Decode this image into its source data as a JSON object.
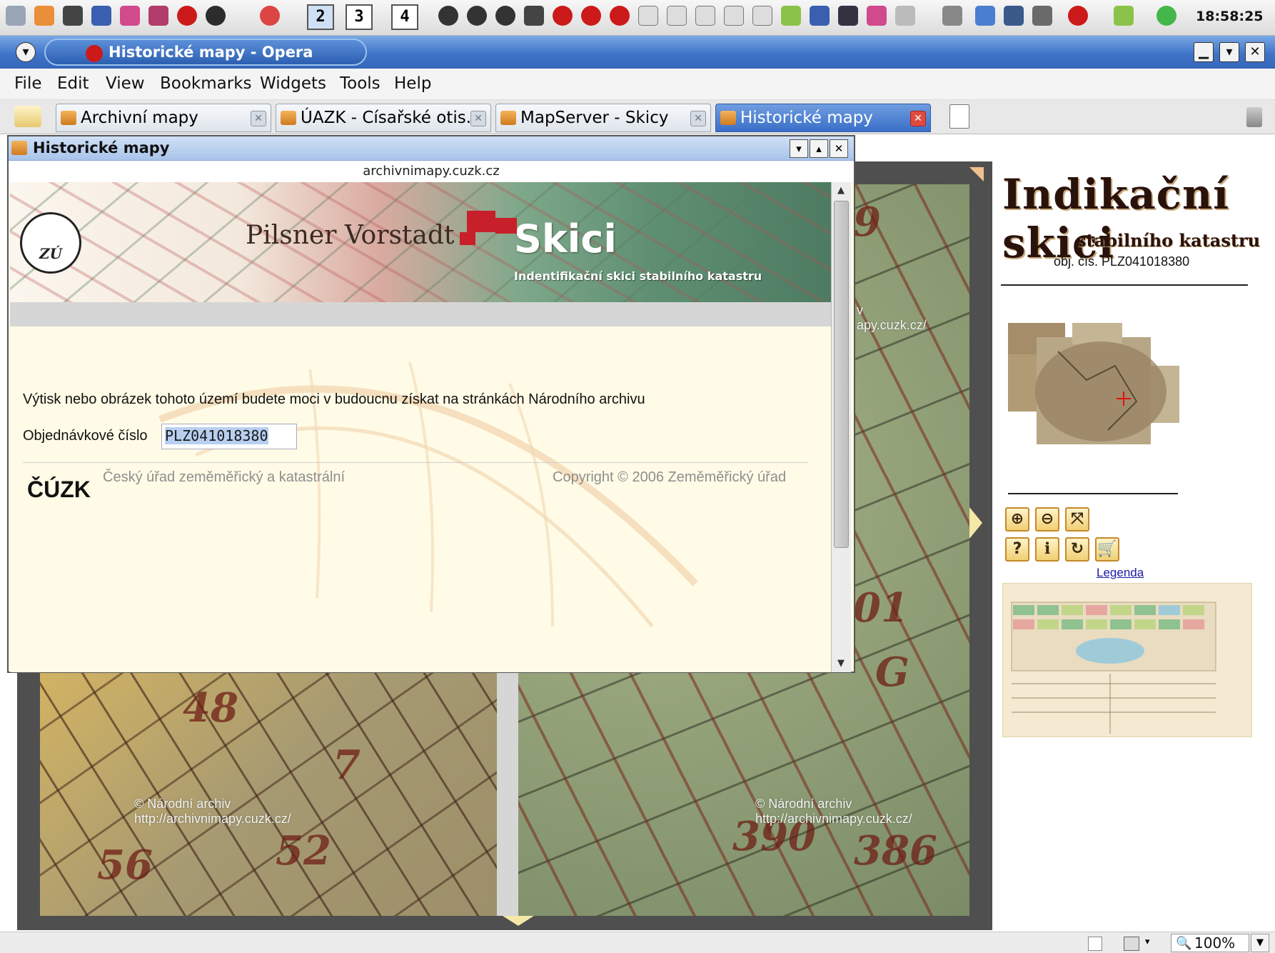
{
  "system_panel": {
    "desktops": [
      "2",
      "3",
      "4"
    ],
    "clock": "18:58:25"
  },
  "window": {
    "title": "Historické mapy - Opera"
  },
  "menu": {
    "items": [
      "File",
      "Edit",
      "View",
      "Bookmarks",
      "Widgets",
      "Tools",
      "Help"
    ]
  },
  "tabs": [
    {
      "label": "Archivní mapy",
      "active": false
    },
    {
      "label": "ÚAZK - Císařské otis...",
      "active": false
    },
    {
      "label": "MapServer - Skicy",
      "active": false
    },
    {
      "label": "Historické mapy",
      "active": true
    }
  ],
  "popup": {
    "title": "Historické mapy",
    "url": "archivnimapy.cuzk.cz",
    "banner": {
      "logo_text": "ZÚ",
      "script_text": "Pilsner Vorstadt",
      "title": "Skici",
      "subtitle": "Indentifikační skici stabilního katastru"
    },
    "notice": "Výtisk nebo obrázek tohoto území budete moci v budoucnu získat na stránkách Národního archivu",
    "order_label": "Objednávkové číslo",
    "order_value": "PLZ041018380",
    "footer": {
      "logo": "ČÚZK",
      "agency": "Český úřad zeměměřický a katastrální",
      "copyright": "Copyright © 2006 Zeměměřický úřad"
    }
  },
  "map": {
    "watermark_line1": "© Národní archiv",
    "watermark_line2": "http://archivnimapy.cuzk.cz/",
    "watermark_partial_line1": "v",
    "watermark_partial_line2": "apy.cuzk.cz/"
  },
  "right_panel": {
    "title": "Indikační skici",
    "subtitle": "stabilního katastru",
    "obj_number": "obj. čís. PLZ041018380",
    "tools_row1": [
      "zoom-in-icon",
      "zoom-out-icon",
      "fit-extent-icon"
    ],
    "tools_row2": [
      "help-icon",
      "info-icon",
      "refresh-icon",
      "cart-icon"
    ],
    "legend_link": "Legenda"
  },
  "status_bar": {
    "zoom": "100%"
  }
}
